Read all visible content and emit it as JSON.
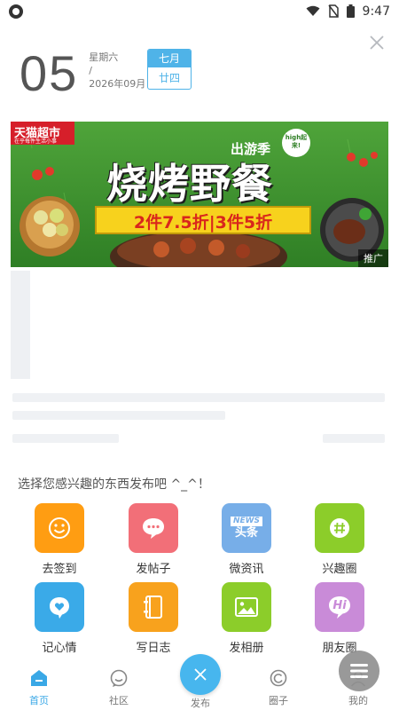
{
  "status_bar": {
    "time": "9:47"
  },
  "date_card": {
    "day": "05",
    "weekday": "星期六",
    "separator": "/",
    "year_month": "2026年09月",
    "lunar_month": "七月",
    "lunar_day": "廿四"
  },
  "banner": {
    "store_name": "天猫超市",
    "store_slogan": "在乎每件生活小事",
    "headline": "烧烤野餐",
    "season_tag": "出游季",
    "badge": "high起来!",
    "offer": "2件7.5折|3件5折",
    "promo_tag": "推广"
  },
  "sheet": {
    "title": "选择您感兴趣的东西发布吧 ^_^！",
    "items": [
      {
        "label": "去签到",
        "icon": "smile-icon",
        "color": "#ff9d12"
      },
      {
        "label": "发帖子",
        "icon": "chat-bubble-icon",
        "color": "#f26f78"
      },
      {
        "label": "微资讯",
        "icon": "news-icon",
        "color": "#77aee8",
        "icon_text_top": "NEWS",
        "icon_text_bottom": "头条"
      },
      {
        "label": "兴趣圈",
        "icon": "hash-icon",
        "color": "#8ccd2a"
      },
      {
        "label": "记心情",
        "icon": "heart-bubble-icon",
        "color": "#3aaae8"
      },
      {
        "label": "写日志",
        "icon": "notebook-icon",
        "color": "#f8a21d"
      },
      {
        "label": "发相册",
        "icon": "photo-icon",
        "color": "#8ccd2a"
      },
      {
        "label": "朋友圈",
        "icon": "hi-bubble-icon",
        "color": "#c98bd8",
        "icon_text": "Hi"
      }
    ]
  },
  "tabbar": {
    "tabs": [
      {
        "label": "首页",
        "icon": "home-icon",
        "active": true
      },
      {
        "label": "社区",
        "icon": "community-icon",
        "active": false
      },
      {
        "label": "发布",
        "icon": "close-icon",
        "active": false
      },
      {
        "label": "圈子",
        "icon": "circle-icon",
        "active": false
      },
      {
        "label": "我的",
        "icon": "profile-icon",
        "active": false
      }
    ]
  },
  "colors": {
    "accent": "#47b6ee",
    "lunar": "#4fb3e8"
  }
}
